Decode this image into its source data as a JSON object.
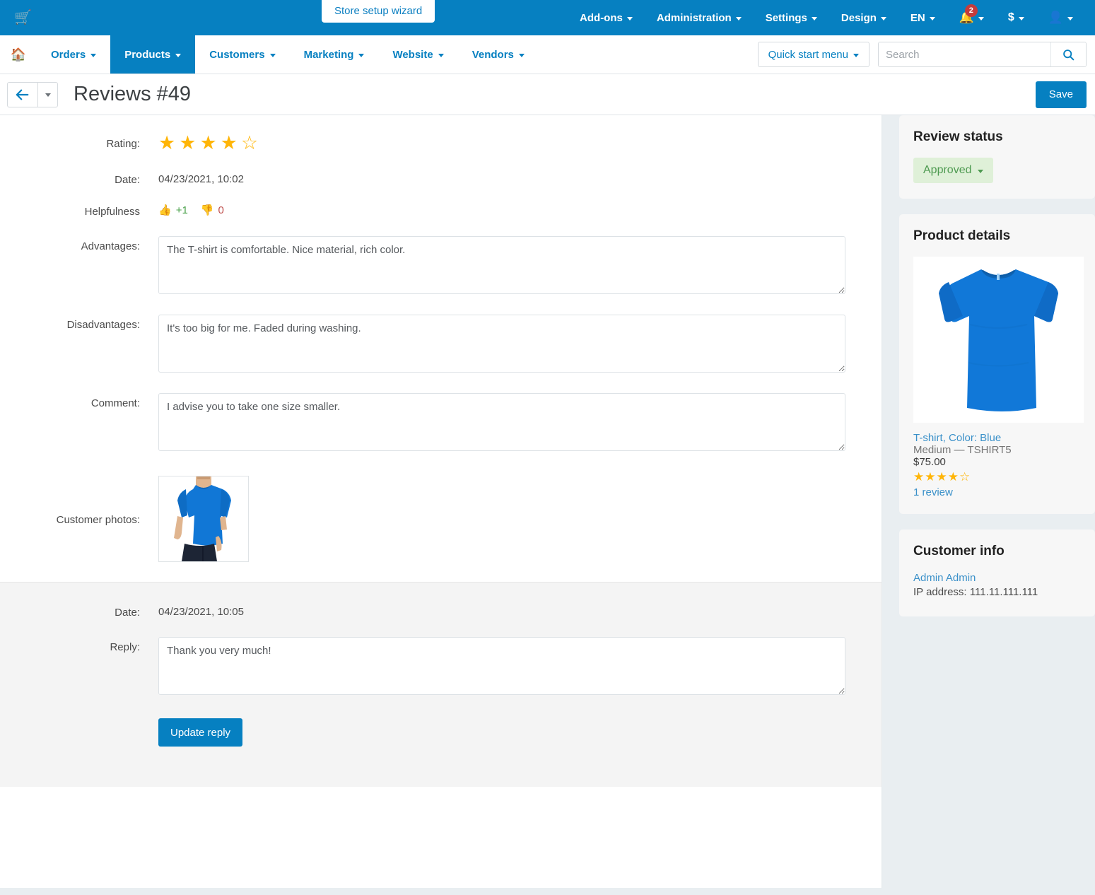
{
  "topbar": {
    "cart_icon": "cart-icon",
    "wizard_label": "Store setup wizard",
    "menus": [
      {
        "label": "Add-ons"
      },
      {
        "label": "Administration"
      },
      {
        "label": "Settings"
      },
      {
        "label": "Design"
      },
      {
        "label": "EN"
      }
    ],
    "notifications_count": "2",
    "currency_symbol": "$"
  },
  "subnav": {
    "home_icon": "home-icon",
    "items": [
      {
        "label": "Orders",
        "active": false
      },
      {
        "label": "Products",
        "active": true
      },
      {
        "label": "Customers",
        "active": false
      },
      {
        "label": "Marketing",
        "active": false
      },
      {
        "label": "Website",
        "active": false
      },
      {
        "label": "Vendors",
        "active": false
      }
    ],
    "quick_start_label": "Quick start menu",
    "search_placeholder": "Search",
    "search_value": ""
  },
  "titlebar": {
    "title": "Reviews #49",
    "save_label": "Save"
  },
  "review": {
    "rating_label": "Rating:",
    "rating_value": 4,
    "rating_max": 5,
    "date_label": "Date:",
    "date_value": "04/23/2021, 10:02",
    "helpfulness_label": "Helpfulness",
    "helpful_up": "+1",
    "helpful_down": "0",
    "advantages_label": "Advantages:",
    "advantages_value": "The T-shirt is comfortable. Nice material, rich color.",
    "disadvantages_label": "Disadvantages:",
    "disadvantages_value": "It's too big for me. Faded during washing.",
    "comment_label": "Comment:",
    "comment_value": "I advise you to take one size smaller.",
    "photos_label": "Customer photos:",
    "photo_alt": "customer-photo-blue-tshirt"
  },
  "reply": {
    "date_label": "Date:",
    "date_value": "04/23/2021, 10:05",
    "reply_label": "Reply:",
    "reply_value": "Thank you very much!",
    "update_label": "Update reply"
  },
  "sidebar": {
    "review_status": {
      "title": "Review status",
      "status": "Approved"
    },
    "product_details": {
      "title": "Product details",
      "image_alt": "blue-tshirt-product-image",
      "name": "T-shirt, Color: Blue",
      "variant": "Medium — TSHIRT5",
      "price": "$75.00",
      "rating_value": 4,
      "rating_max": 5,
      "reviews_link": "1 review"
    },
    "customer_info": {
      "title": "Customer info",
      "name": "Admin Admin",
      "ip_label": "IP address:",
      "ip_value": "111.11.111.111"
    }
  },
  "colors": {
    "brand_blue": "#0680c1",
    "star_gold": "#ffb507",
    "approved_green": "#4e9a51",
    "approved_bg": "#dff0d8",
    "badge_red": "#c43b3b",
    "link_blue": "#3a90c9"
  }
}
